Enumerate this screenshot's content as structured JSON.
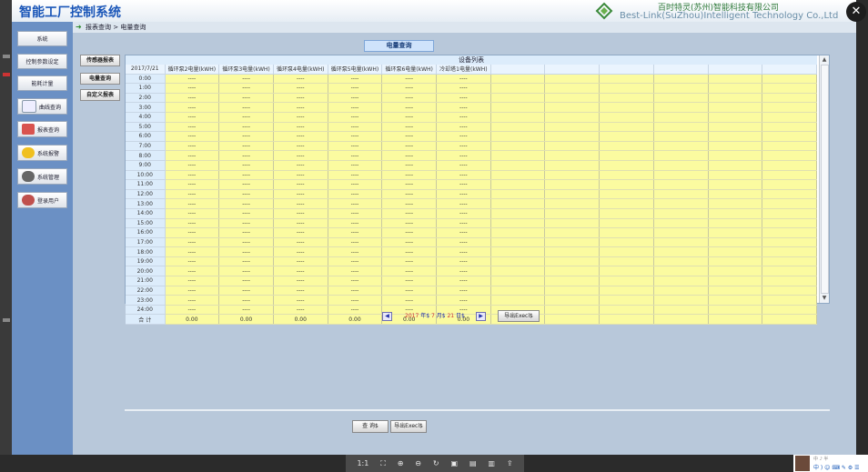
{
  "app": {
    "title": "智能工厂控制系统",
    "company_cn": "百时特灵(苏州)智能科技有限公司",
    "company_en": "Best-Link(SuZhou)Intelligent Technology Co.,Ltd"
  },
  "sidebar": {
    "items": [
      {
        "label": "系统"
      },
      {
        "label": "控制参数设定"
      },
      {
        "label": "能耗计量"
      },
      {
        "label": "曲线查询"
      },
      {
        "label": "报表查询"
      },
      {
        "label": "系统报警"
      },
      {
        "label": "系统管理"
      },
      {
        "label": "登录用户"
      }
    ]
  },
  "breadcrumb": {
    "text": "报表查询 > 电量查询"
  },
  "page_tab": {
    "label": "电量查询"
  },
  "report_buttons": [
    {
      "label": "传感器报表"
    },
    {
      "label": "电量查询"
    },
    {
      "label": "自定义报表"
    }
  ],
  "grid": {
    "title": "设备列表",
    "date_header": "2017/7/21",
    "columns": [
      "循环泵2电量(kWH)",
      "循环泵3电量(kWH)",
      "循环泵4电量(kWH)",
      "循环泵5电量(kWH)",
      "循环泵6电量(kWH)",
      "冷却塔1电量(kWH)"
    ],
    "extra_blank_columns": 6,
    "rows": [
      "0:00",
      "1:00",
      "2:00",
      "3:00",
      "4:00",
      "5:00",
      "6:00",
      "7:00",
      "8:00",
      "9:00",
      "10:00",
      "11:00",
      "12:00",
      "13:00",
      "14:00",
      "15:00",
      "16:00",
      "17:00",
      "18:00",
      "19:00",
      "20:00",
      "21:00",
      "22:00",
      "23:00",
      "24:00"
    ],
    "empty_value": "----",
    "total_label": "合  计",
    "totals": [
      "0.00",
      "0.00",
      "0.00",
      "0.00",
      "0.00",
      "0.00"
    ]
  },
  "date_selector": {
    "year": "2017",
    "year_suffix": "年$",
    "month": "7",
    "month_suffix": "月$",
    "day": "21",
    "day_suffix": "日$",
    "prev": "◀",
    "next": "▶"
  },
  "buttons": {
    "export_top": "导出Execl$",
    "query": "查 询$",
    "export_bottom": "导出Execl$"
  },
  "viewer_toolbar": [
    "1:1",
    "⛶",
    "⊕",
    "⊖",
    "↻",
    "▣",
    "▤",
    "▥",
    "⇪"
  ],
  "ime_bar": {
    "top": "中 ♪ 半",
    "bottom": "中 ) ☺ ⌨ ✎ ⚙ ☰"
  }
}
